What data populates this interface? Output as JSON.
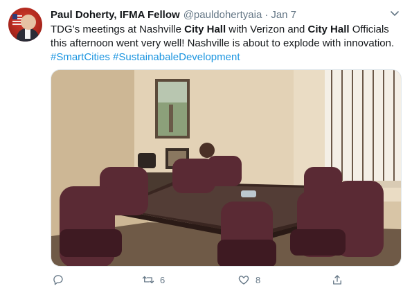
{
  "tweet": {
    "author_name": "Paul Doherty, IFMA Fellow",
    "handle": "@pauldohertyaia",
    "separator": "·",
    "date": "Jan 7",
    "text_parts": [
      {
        "t": "TDG’s meetings at Nashville "
      },
      {
        "t": "City Hall",
        "style": "bold"
      },
      {
        "t": " with Verizon and "
      },
      {
        "t": "City Hall",
        "style": "bold"
      },
      {
        "t": " Officials this afternoon went very well! Nashville is about to explode with innovation. "
      },
      {
        "t": "#SmartCities",
        "style": "tag"
      },
      {
        "t": " "
      },
      {
        "t": "#SustainabaleDevelopment",
        "style": "tag"
      }
    ],
    "media": {
      "description_icon": "photo"
    }
  },
  "actions": {
    "reply_count": "",
    "retweet_count": "6",
    "like_count": "8"
  },
  "colors": {
    "text_primary": "#14171a",
    "text_secondary": "#657786",
    "link": "#1b95e0"
  }
}
